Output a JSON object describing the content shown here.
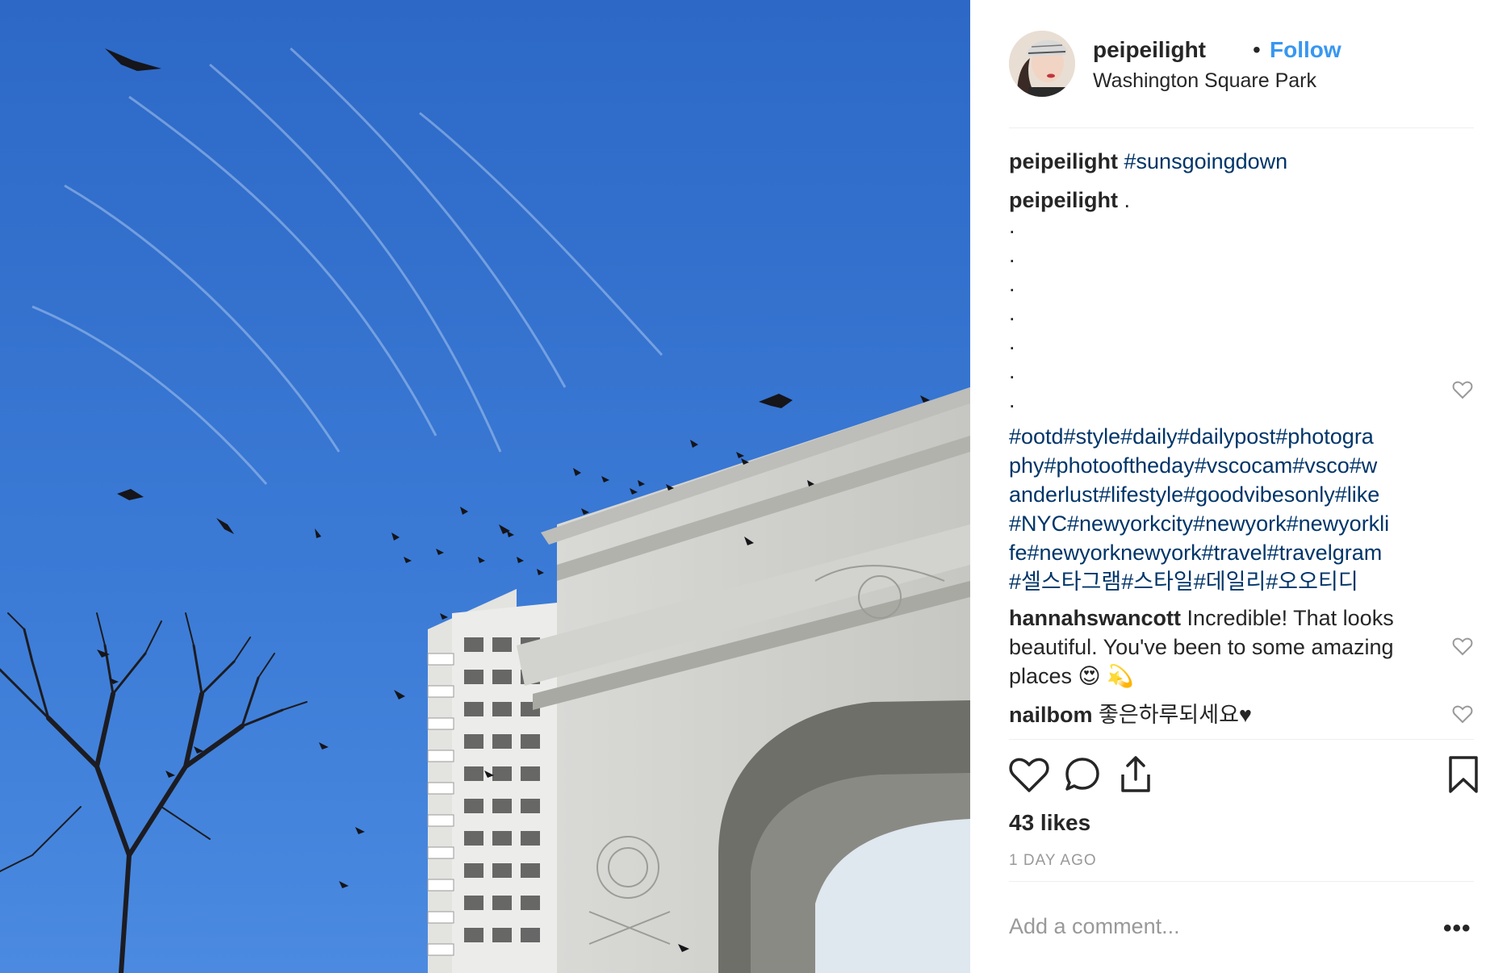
{
  "post": {
    "username": "peipeilight",
    "separator": "•",
    "follow_label": "Follow",
    "location": "Washington Square Park"
  },
  "caption": {
    "username": "peipeilight",
    "hashtag": "#sunsgoingdown"
  },
  "second_comment": {
    "username": "peipeilight",
    "text": ".",
    "dots": [
      ".",
      ".",
      ".",
      ".",
      ".",
      ".",
      "."
    ],
    "hashtag_lines": [
      "#ootd#style#daily#dailypost#photogra",
      "phy#photooftheday#vscocam#vsco#w",
      "anderlust#lifestyle#goodvibesonly#like",
      "#NYC#newyorkcity#newyork#newyorkli",
      "fe#newyorknewyork#travel#travelgram",
      "#셀스타그램#스타일#데일리#오오티디"
    ]
  },
  "comments": [
    {
      "username": "hannahswancott",
      "lines": [
        "Incredible! That looks",
        "beautiful. You've been to some amazing",
        "places 😍 💫"
      ]
    },
    {
      "username": "nailbom",
      "text": "좋은하루되세요♥"
    }
  ],
  "likes_label": "43 likes",
  "time_label": "1 DAY AGO",
  "add_comment_placeholder": "Add a comment...",
  "more_label": "•••",
  "icons": {
    "like": "heart-icon",
    "comment": "comment-bubble-icon",
    "share": "share-upload-icon",
    "save": "bookmark-icon",
    "comment_like": "heart-outline-icon"
  },
  "colors": {
    "link": "#3897f0",
    "hashtag": "#003569",
    "muted": "#999999",
    "text": "#262626",
    "sky": "#2f6fd0"
  }
}
